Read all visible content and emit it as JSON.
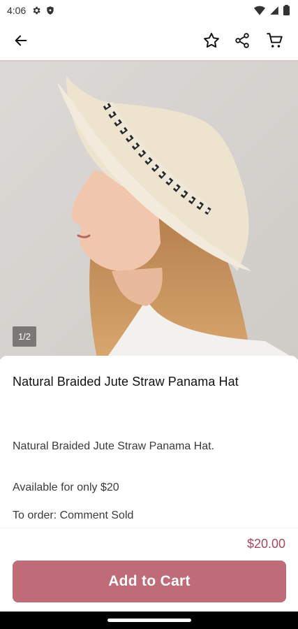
{
  "status_bar": {
    "time": "4:06",
    "left_icons": [
      "gear-icon",
      "shield-icon"
    ],
    "right_icons": [
      "wifi-icon",
      "signal-icon",
      "battery-icon"
    ]
  },
  "app_bar": {
    "icons": [
      "back-arrow-icon",
      "star-outline-icon",
      "share-icon",
      "cart-icon"
    ]
  },
  "product": {
    "image_counter": "1/2",
    "title": "Natural Braided Jute Straw Panama Hat",
    "description_lines": [
      "Natural Braided Jute Straw Panama Hat.",
      "Available for only $20",
      "To order: Comment Sold"
    ],
    "price": "$20.00",
    "add_to_cart_label": "Add to Cart"
  },
  "colors": {
    "accent_button": "#c06b78",
    "price_text": "#a8485c"
  }
}
